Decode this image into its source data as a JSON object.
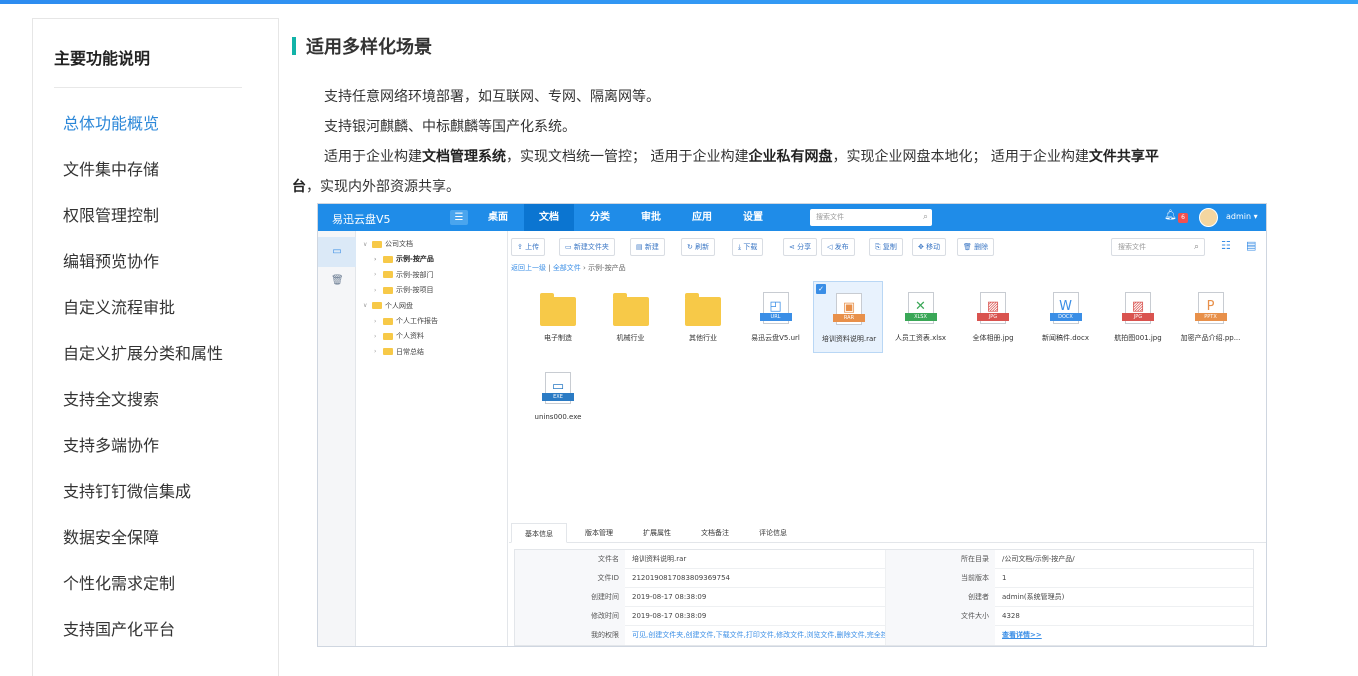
{
  "sidebar": {
    "title": "主要功能说明",
    "items": [
      {
        "label": "总体功能概览",
        "active": true
      },
      {
        "label": "文件集中存储"
      },
      {
        "label": "权限管理控制"
      },
      {
        "label": "编辑预览协作"
      },
      {
        "label": "自定义流程审批"
      },
      {
        "label": "自定义扩展分类和属性"
      },
      {
        "label": "支持全文搜索"
      },
      {
        "label": "支持多端协作"
      },
      {
        "label": "支持钉钉微信集成"
      },
      {
        "label": "数据安全保障"
      },
      {
        "label": "个性化需求定制"
      },
      {
        "label": "支持国产化平台"
      }
    ]
  },
  "section": {
    "title": "适用多样化场景",
    "p1": "支持任意网络环境部署，如互联网、专网、隔离网等。",
    "p2": "支持银河麒麟、中标麒麟等国产化系统。",
    "p3_a": "适用于企业构建",
    "p3_b": "文档管理系统",
    "p3_c": "，实现文档统一管控； 适用于企业构建",
    "p3_d": "企业私有网盘",
    "p3_e": "，实现企业网盘本地化； 适用于企业构建",
    "p3_f": "文件共享平",
    "p4_a": "台",
    "p4_b": "，实现内外部资源共享。"
  },
  "app": {
    "brand": "易迅云盘V5",
    "menu_icon": "menu-icon",
    "tabs": [
      "桌面",
      "文档",
      "分类",
      "审批",
      "应用",
      "设置"
    ],
    "active_tab": "文档",
    "search_placeholder": "搜索文件",
    "badge": "6",
    "user": "admin ▾",
    "tree": [
      {
        "label": "公司文档",
        "level": 0,
        "arrow": "∨"
      },
      {
        "label": "示例-按产品",
        "level": 1,
        "arrow": "›",
        "selected": true
      },
      {
        "label": "示例-按部门",
        "level": 1,
        "arrow": "›"
      },
      {
        "label": "示例-按项目",
        "level": 1,
        "arrow": "›"
      },
      {
        "label": "个人网盘",
        "level": 0,
        "arrow": "∨"
      },
      {
        "label": "个人工作报告",
        "level": 1,
        "arrow": "›"
      },
      {
        "label": "个人资料",
        "level": 1,
        "arrow": "›"
      },
      {
        "label": "日常总结",
        "level": 1,
        "arrow": "›"
      }
    ],
    "toolbar": [
      {
        "label": "⇪ 上传"
      },
      {
        "label": "▭ 新建文件夹"
      },
      {
        "label": "▤ 新建"
      },
      {
        "label": "↻ 刷新"
      },
      {
        "label": "⤓ 下载"
      },
      {
        "label": "⋖ 分享"
      },
      {
        "label": "◁ 发布"
      },
      {
        "label": "⎘ 复制"
      },
      {
        "label": "✥ 移动"
      },
      {
        "label": "🗑 删除"
      }
    ],
    "toolbar_search": "搜索文件",
    "breadcrumb": {
      "back": "返回上一级",
      "sep": " | ",
      "all": "全部文件",
      "arrow": " › ",
      "current": "示例-按产品"
    },
    "files": [
      {
        "name": "电子制造",
        "type": "folder"
      },
      {
        "name": "机械行业",
        "type": "folder"
      },
      {
        "name": "其他行业",
        "type": "folder"
      },
      {
        "name": "易迅云盘V5.url",
        "type": "doc",
        "tag": "URL",
        "tag_color": "#3a8ee6",
        "glyph": "◰",
        "glyph_color": "#3a8ee6"
      },
      {
        "name": "培训资料说明.rar",
        "type": "doc",
        "tag": "RAR",
        "tag_color": "#e8904a",
        "glyph": "▣",
        "glyph_color": "#e8904a",
        "selected": true,
        "check": "✓"
      },
      {
        "name": "人员工资表.xlsx",
        "type": "doc",
        "tag": "XLSX",
        "tag_color": "#3aa757",
        "glyph": "✕",
        "glyph_color": "#3aa757"
      },
      {
        "name": "全体相册.jpg",
        "type": "doc",
        "tag": "JPG",
        "tag_color": "#d9534f",
        "glyph": "▨",
        "glyph_color": "#d9534f"
      },
      {
        "name": "新闻稿件.docx",
        "type": "doc",
        "tag": "DOCX",
        "tag_color": "#3a8ee6",
        "glyph": "W",
        "glyph_color": "#3a8ee6"
      },
      {
        "name": "航拍图001.jpg",
        "type": "doc",
        "tag": "JPG",
        "tag_color": "#d9534f",
        "glyph": "▨",
        "glyph_color": "#d9534f"
      },
      {
        "name": "加密产品介绍.pp...",
        "type": "doc",
        "tag": "PPTX",
        "tag_color": "#e8904a",
        "glyph": "P",
        "glyph_color": "#e8904a"
      },
      {
        "name": "unins000.exe",
        "type": "doc",
        "tag": "EXE",
        "tag_color": "#2b7bc4",
        "glyph": "▭",
        "glyph_color": "#2b7bc4"
      }
    ],
    "detail_tabs": [
      "基本信息",
      "版本管理",
      "扩展属性",
      "文档备注",
      "评论信息"
    ],
    "detail_rows": [
      {
        "l1": "文件名",
        "v1": "培训资料说明.rar",
        "l2": "所在目录",
        "v2": "/公司文档/示例-按产品/"
      },
      {
        "l1": "文件ID",
        "v1": "21201908170838093697​54",
        "l2": "当前版本",
        "v2": "1"
      },
      {
        "l1": "创建时间",
        "v1": "2019-08-17 08:38:09",
        "l2": "创建者",
        "v2": "admin(系统管理员)"
      },
      {
        "l1": "修改时间",
        "v1": "2019-08-17 08:38:09",
        "l2": "文件大小",
        "v2": "4328"
      },
      {
        "l1": "我的权限",
        "v1": "可见,创建文件夹,创建文件,下载文件,打印文件,修改文件,浏览文件,删除文件,完全控制",
        "l2": "",
        "v2": "查看详情>>"
      }
    ]
  }
}
